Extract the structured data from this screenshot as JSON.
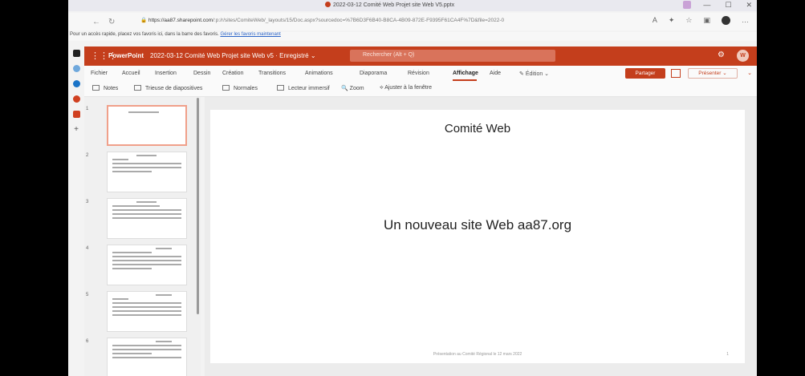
{
  "browser": {
    "title": "2022-03-12 Comité Web Projet site Web V5.pptx",
    "url_host": "https://aa87.sharepoint.com",
    "url_path": "/:p:/r/sites/ComiteWeb/_layouts/15/Doc.aspx?sourcedoc=%7B6D3F6B40-B8CA-4B09-872E-F9395F61CA4F%7D&file=2022-0",
    "favorites_text": "Pour un accès rapide, placez vos favoris ici, dans la barre des favoris.",
    "favorites_link": "Gérer les favoris maintenant"
  },
  "ppt": {
    "app_name": "PowerPoint",
    "doc_title": "2022-03-12 Comité Web Projet site Web v5",
    "save_state": "Enregistré",
    "search_placeholder": "Rechercher (Alt + Q)",
    "user_initial": "W"
  },
  "ribbon": {
    "tabs": [
      "Fichier",
      "Accueil",
      "Insertion",
      "Dessin",
      "Création",
      "Transitions",
      "Animations",
      "Diaporama",
      "Révision",
      "Affichage",
      "Aide"
    ],
    "active_tab": "Affichage",
    "edit_mode": "Édition",
    "share": "Partager",
    "present": "Présenter"
  },
  "toolbar": {
    "notes": "Notes",
    "sorter": "Trieuse de diapositives",
    "normal": "Normales",
    "reader": "Lecteur immersif",
    "zoom": "Zoom",
    "fit": "Ajuster à la fenêtre"
  },
  "thumbnails": [
    "1",
    "2",
    "3",
    "4",
    "5",
    "6"
  ],
  "slide": {
    "title": "Comité Web",
    "subtitle": "Un nouveau site Web aa87.org",
    "footer": "Présentation au Comité Régional le 12 mars 2022",
    "number": "1"
  }
}
